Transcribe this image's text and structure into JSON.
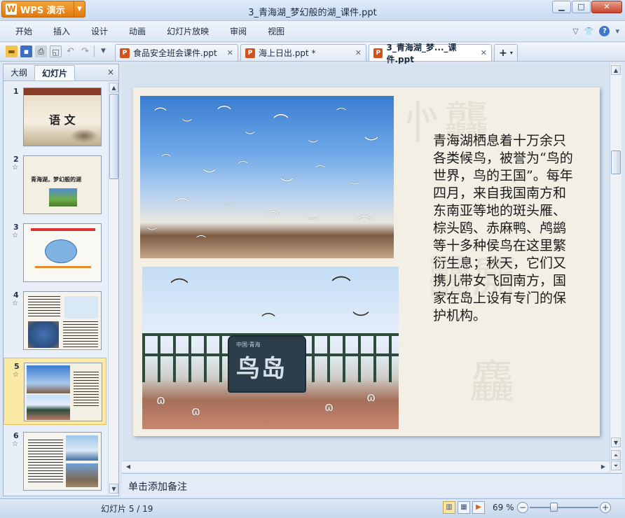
{
  "app": {
    "wps_label": "WPS 演示",
    "window_title": "3_青海湖_梦幻般的湖_课件.ppt"
  },
  "window_controls": {
    "minimize": "▁",
    "maximize": "□",
    "close": "✕"
  },
  "menu": {
    "items": [
      "开始",
      "插入",
      "设计",
      "动画",
      "幻灯片放映",
      "审阅",
      "视图"
    ]
  },
  "toolbar": {
    "tabs": [
      {
        "label": "食品安全班会课件.ppt"
      },
      {
        "label": "海上日出.ppt *"
      },
      {
        "label": "3_青海湖_梦..._课件.ppt"
      }
    ],
    "new_tab_label": "+"
  },
  "panel": {
    "tab_outline": "大纲",
    "tab_slides": "幻灯片",
    "close": "×",
    "slides": [
      {
        "num": "1",
        "title": "语 文"
      },
      {
        "num": "2",
        "title": "青海湖，梦幻般的湖"
      },
      {
        "num": "3",
        "title": ""
      },
      {
        "num": "4",
        "title": ""
      },
      {
        "num": "5",
        "title": ""
      },
      {
        "num": "6",
        "title": ""
      }
    ],
    "selected_index": 5
  },
  "slide": {
    "body_text": "青海湖栖息着十万余只各类候鸟，被誉为“鸟的世界，鸟的王国”。每年四月，来自我国南方和东南亚等地的斑头雁、棕头鸥、赤麻鸭、鸬鹚等十多种侯鸟在这里繁衍生息；秋天，它们又携儿带女飞回南方，国家在岛上设有专门的保护机构。",
    "rock_small_text": "中国·青海",
    "rock_big_text": "鸟岛"
  },
  "notes": {
    "placeholder": "单击添加备注"
  },
  "status": {
    "slide_counter": "幻灯片 5 / 19",
    "zoom": "69 %"
  },
  "colors": {
    "accent": "#e07a10",
    "selection": "#fbe9a6",
    "chrome": "#dbe6f4"
  }
}
